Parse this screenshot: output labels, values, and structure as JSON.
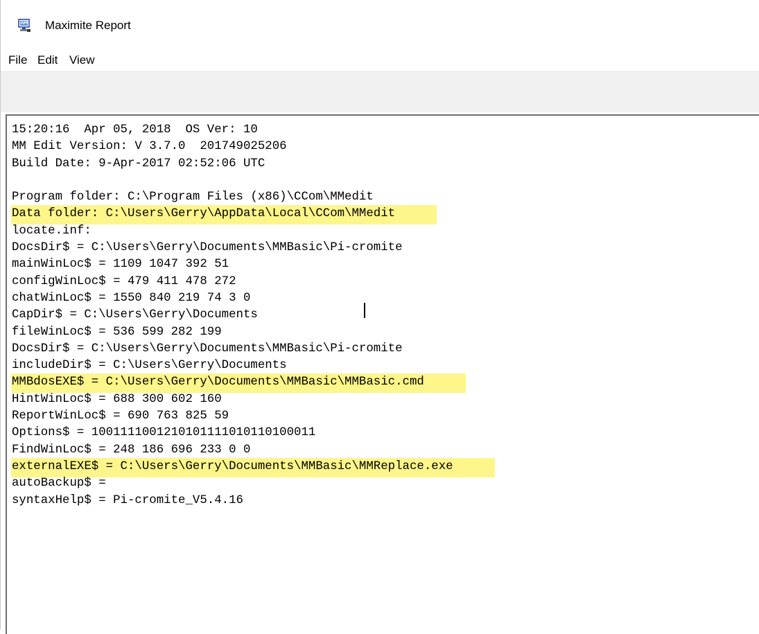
{
  "window": {
    "title": "Maximite Report",
    "icon": "monitor-app-icon"
  },
  "menu": {
    "items": [
      "File",
      "Edit",
      "View"
    ]
  },
  "report": {
    "highlight_color": "#fef68a",
    "lines": [
      {
        "text": "15:20:16  Apr 05, 2018  OS Ver: 10",
        "highlight": false
      },
      {
        "text": "MM Edit Version: V 3.7.0  201749025206",
        "highlight": false
      },
      {
        "text": "Build Date: 9-Apr-2017 02:52:06 UTC",
        "highlight": false
      },
      {
        "text": "",
        "highlight": false
      },
      {
        "text": "Program folder: C:\\Program Files (x86)\\CCom\\MMedit",
        "highlight": false
      },
      {
        "text": "Data folder: C:\\Users\\Gerry\\AppData\\Local\\CCom\\MMedit",
        "highlight": true
      },
      {
        "text": "locate.inf:",
        "highlight": false
      },
      {
        "text": "DocsDir$ = C:\\Users\\Gerry\\Documents\\MMBasic\\Pi-cromite",
        "highlight": false
      },
      {
        "text": "mainWinLoc$ = 1109 1047 392 51",
        "highlight": false
      },
      {
        "text": "configWinLoc$ = 479 411 478 272",
        "highlight": false
      },
      {
        "text": "chatWinLoc$ = 1550 840 219 74 3 0",
        "highlight": false
      },
      {
        "text": "CapDir$ = C:\\Users\\Gerry\\Documents",
        "highlight": false
      },
      {
        "text": "fileWinLoc$ = 536 599 282 199",
        "highlight": false
      },
      {
        "text": "DocsDir$ = C:\\Users\\Gerry\\Documents\\MMBasic\\Pi-cromite",
        "highlight": false
      },
      {
        "text": "includeDir$ = C:\\Users\\Gerry\\Documents",
        "highlight": false
      },
      {
        "text": "MMBdosEXE$ = C:\\Users\\Gerry\\Documents\\MMBasic\\MMBasic.cmd",
        "highlight": true
      },
      {
        "text": "HintWinLoc$ = 688 300 602 160",
        "highlight": false
      },
      {
        "text": "ReportWinLoc$ = 690 763 825 59",
        "highlight": false
      },
      {
        "text": "Options$ = 1001111001210101111010110100011",
        "highlight": false
      },
      {
        "text": "FindWinLoc$ = 248 186 696 233 0 0",
        "highlight": false
      },
      {
        "text": "externalEXE$ = C:\\Users\\Gerry\\Documents\\MMBasic\\MMReplace.exe",
        "highlight": true
      },
      {
        "text": "autoBackup$ =",
        "highlight": false
      },
      {
        "text": "syntaxHelp$ = Pi-cromite_V5.4.16",
        "highlight": false
      }
    ]
  }
}
